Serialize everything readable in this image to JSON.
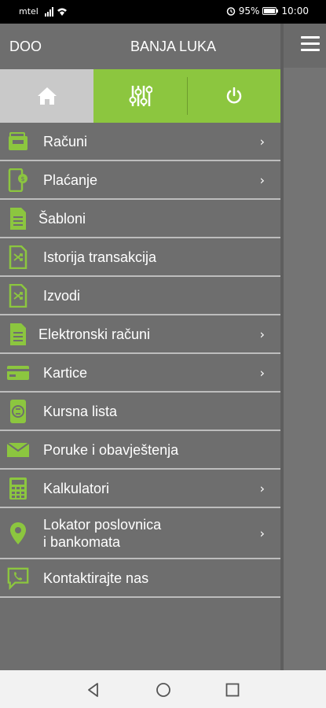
{
  "status_bar": {
    "carrier": "mtel",
    "battery": "95%",
    "time": "10:00"
  },
  "header": {
    "company": "DOO",
    "city": "BANJA LUKA"
  },
  "quick_tabs": [
    {
      "icon": "home-icon"
    },
    {
      "icon": "sliders-icon"
    },
    {
      "icon": "power-icon"
    }
  ],
  "menu": {
    "items": [
      {
        "label": "Računi",
        "icon": "wallet-icon",
        "has_chevron": true
      },
      {
        "label": "Plaćanje",
        "icon": "mobile-payment-icon",
        "has_chevron": true
      },
      {
        "label": "Šabloni",
        "icon": "document-icon",
        "has_chevron": false
      },
      {
        "label": "Istorija transakcija",
        "icon": "shuffle-document-icon",
        "has_chevron": false
      },
      {
        "label": "Izvodi",
        "icon": "shuffle-document-icon",
        "has_chevron": false
      },
      {
        "label": "Elektronski računi",
        "icon": "document-icon",
        "has_chevron": true
      },
      {
        "label": "Kartice",
        "icon": "credit-card-icon",
        "has_chevron": true
      },
      {
        "label": "Kursna lista",
        "icon": "exchange-phone-icon",
        "has_chevron": false
      },
      {
        "label": "Poruke i obavještenja",
        "icon": "envelope-icon",
        "has_chevron": false
      },
      {
        "label": "Kalkulatori",
        "icon": "calculator-icon",
        "has_chevron": true
      },
      {
        "label_line1": "Lokator poslovnica",
        "label_line2": "i bankomata",
        "icon": "location-pin-icon",
        "has_chevron": true
      },
      {
        "label": "Kontaktirajte nas",
        "icon": "phone-chat-icon",
        "has_chevron": false
      }
    ],
    "chevron": "›"
  },
  "colors": {
    "accent_green": "#8cc63f",
    "drawer_bg": "#6e6e6e",
    "selected_tab": "#c9c9c9"
  }
}
